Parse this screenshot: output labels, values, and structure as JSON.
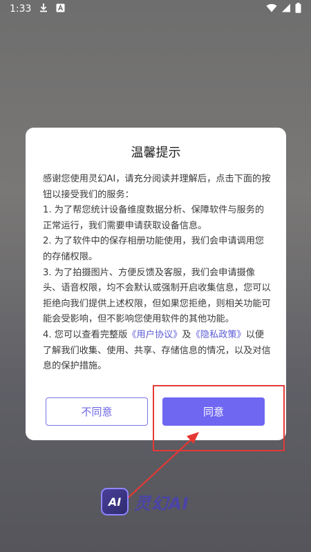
{
  "status_bar": {
    "time": "1:33"
  },
  "dialog": {
    "title": "温馨提示",
    "intro": "感谢您使用灵幻AI，请充分阅读并理解后，点击下面的按钮以接受我们的服务：",
    "item1": "1. 为了帮您统计设备维度数据分析、保障软件与服务的正常运行，我们需要申请获取设备信息。",
    "item2": "2. 为了软件中的保存相册功能使用，我们会申请调用您的存储权限。",
    "item3": "3. 为了拍摄图片、方便反馈及客服，我们会申请摄像头、语音权限，均不会默认或强制开启收集信息，您可以拒绝向我们提供上述权限，但如果您拒绝，则相关功能可能会受影响，但不影响您使用软件的其他功能。",
    "item4_prefix": "4. 您可以查看完整版",
    "user_agreement_link": "《用户协议》",
    "item4_and": "及",
    "privacy_policy_link": "《隐私政策》",
    "item4_suffix": "以便了解我们收集、使用、共享、存储信息的情况，以及对信息的保护措施。",
    "disagree_label": "不同意",
    "agree_label": "同意"
  },
  "logo": {
    "mark_text": "AI",
    "text": "灵幻AI"
  },
  "colors": {
    "accent": "#6f66f2",
    "highlight": "#e53935",
    "link": "#5b5bd6"
  }
}
